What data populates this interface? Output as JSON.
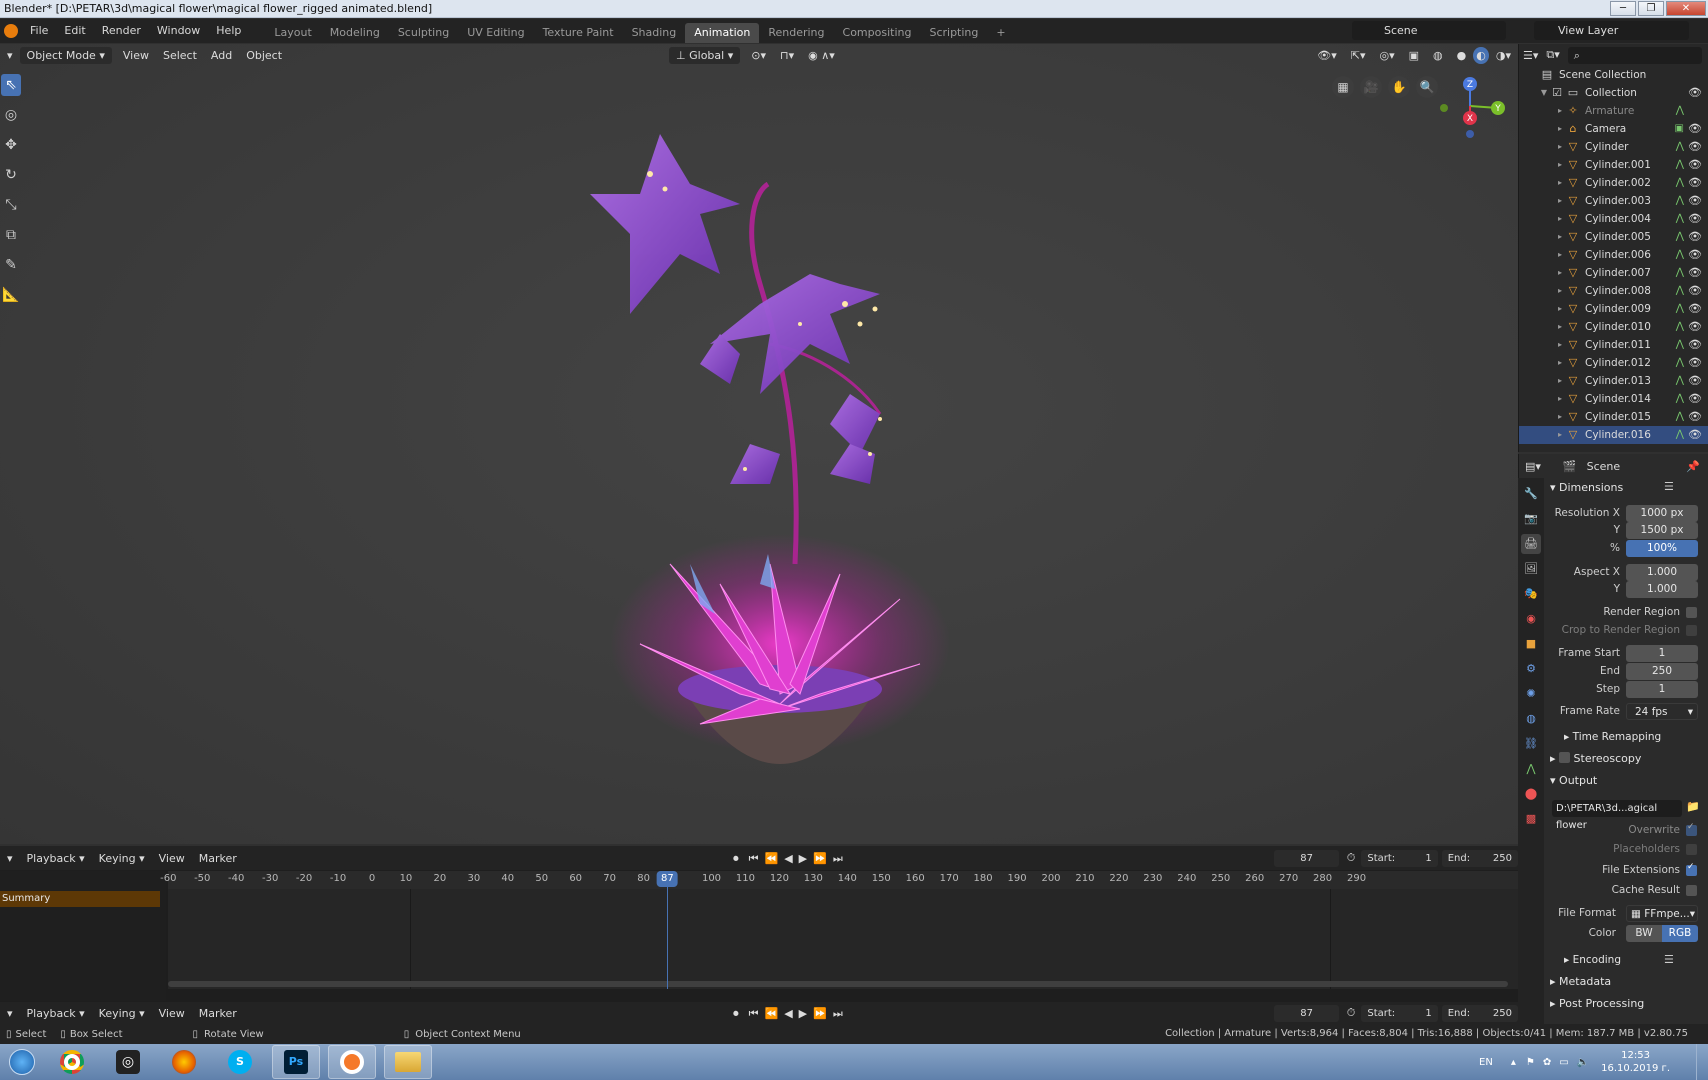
{
  "window": {
    "title": "Blender* [D:\\PETAR\\3d\\magical flower\\magical flower_rigged animated.blend]"
  },
  "menubar": {
    "items": [
      "File",
      "Edit",
      "Render",
      "Window",
      "Help"
    ],
    "workspaces": [
      "Layout",
      "Modeling",
      "Sculpting",
      "UV Editing",
      "Texture Paint",
      "Shading",
      "Animation",
      "Rendering",
      "Compositing",
      "Scripting"
    ],
    "active_workspace": "Animation",
    "add_tab": "+",
    "scene": "Scene",
    "view_layer": "View Layer"
  },
  "viewport": {
    "mode": "Object Mode",
    "menus": [
      "View",
      "Select",
      "Add",
      "Object"
    ],
    "orientation": "Global",
    "gizmo": {
      "z": "Z",
      "y": "Y",
      "x": "X"
    }
  },
  "timeline": {
    "menus": [
      "Playback",
      "Keying",
      "View",
      "Marker"
    ],
    "current_frame": "87",
    "start_label": "Start:",
    "start": "1",
    "end_label": "End:",
    "end": "250",
    "ticks": [
      "-60",
      "-50",
      "-40",
      "-30",
      "-20",
      "-10",
      "0",
      "10",
      "20",
      "30",
      "40",
      "50",
      "60",
      "70",
      "80",
      "87",
      "100",
      "110",
      "120",
      "130",
      "140",
      "150",
      "160",
      "170",
      "180",
      "190",
      "200",
      "210",
      "220",
      "230",
      "240",
      "250",
      "260",
      "270",
      "280",
      "290"
    ],
    "summary": "Summary"
  },
  "statusbar": {
    "select": "Select",
    "box_select": "Box Select",
    "rotate": "Rotate View",
    "context": "Object Context Menu",
    "stats": "Collection | Armature | Verts:8,964 | Faces:8,804 | Tris:16,888 | Objects:0/41 | Mem: 187.7 MB | v2.80.75"
  },
  "outliner": {
    "root": "Scene Collection",
    "collection": "Collection",
    "items": [
      "Armature",
      "Camera",
      "Cylinder",
      "Cylinder.001",
      "Cylinder.002",
      "Cylinder.003",
      "Cylinder.004",
      "Cylinder.005",
      "Cylinder.006",
      "Cylinder.007",
      "Cylinder.008",
      "Cylinder.009",
      "Cylinder.010",
      "Cylinder.011",
      "Cylinder.012",
      "Cylinder.013",
      "Cylinder.014",
      "Cylinder.015",
      "Cylinder.016"
    ],
    "selected": "Cylinder.016"
  },
  "properties": {
    "context": "Scene",
    "dimensions": "Dimensions",
    "res_x_label": "Resolution X",
    "res_x": "1000 px",
    "res_y_label": "Y",
    "res_y": "1500 px",
    "res_pct_label": "%",
    "res_pct": "100%",
    "aspect_x_label": "Aspect X",
    "aspect_x": "1.000",
    "aspect_y_label": "Y",
    "aspect_y": "1.000",
    "render_region": "Render Region",
    "crop_region": "Crop to Render Region",
    "frame_start_label": "Frame Start",
    "frame_start": "1",
    "frame_end_label": "End",
    "frame_end": "250",
    "frame_step_label": "Step",
    "frame_step": "1",
    "frame_rate_label": "Frame Rate",
    "frame_rate": "24 fps",
    "time_remapping": "Time Remapping",
    "stereoscopy": "Stereoscopy",
    "output": "Output",
    "output_path": "D:\\PETAR\\3d...agical flower",
    "overwrite": "Overwrite",
    "placeholders": "Placeholders",
    "file_extensions": "File Extensions",
    "cache_result": "Cache Result",
    "file_format_label": "File Format",
    "file_format": "FFmpe...",
    "color_label": "Color",
    "color_bw": "BW",
    "color_rgb": "RGB",
    "encoding": "Encoding",
    "metadata": "Metadata",
    "post_processing": "Post Processing"
  },
  "taskbar": {
    "lang": "EN",
    "time": "12:53",
    "date": "16.10.2019 г."
  },
  "colors": {
    "accent": "#4772b3",
    "summary": "#5d3806",
    "playhead": "#4772b3"
  }
}
